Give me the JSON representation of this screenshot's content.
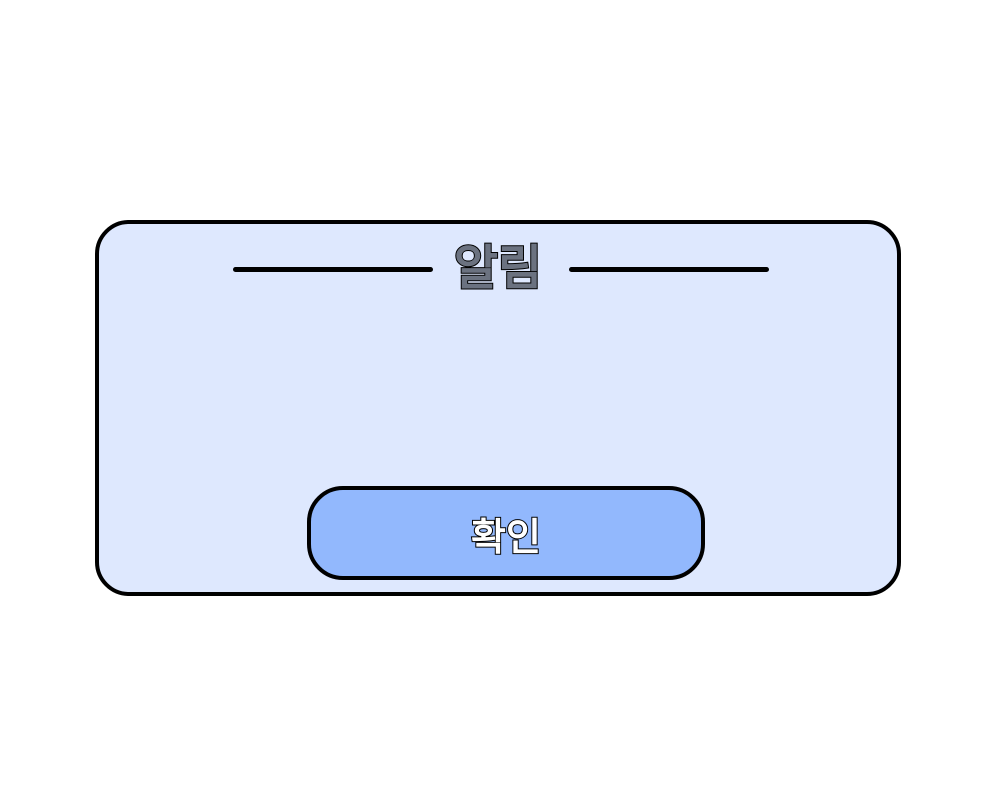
{
  "dialog": {
    "title": "알림",
    "confirm_label": "확인"
  },
  "colors": {
    "dialog_background": "#dee8fe",
    "button_background": "#92b8fd",
    "title_text": "#6b7280",
    "outline": "#000000"
  }
}
